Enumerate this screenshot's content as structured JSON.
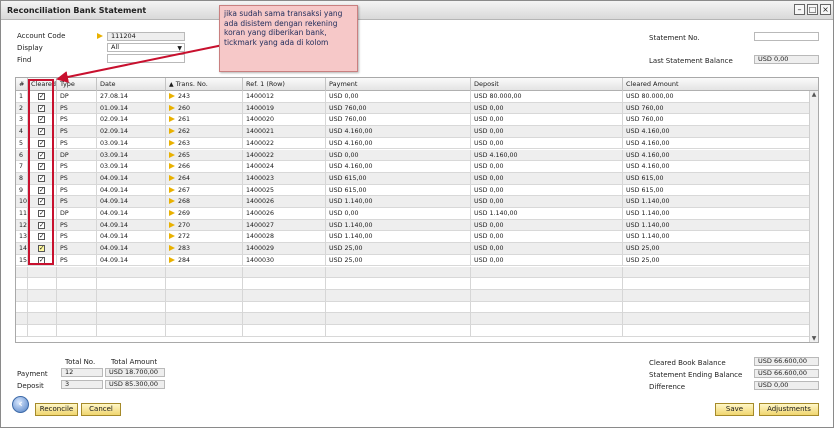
{
  "window": {
    "title": "Reconciliation Bank Statement"
  },
  "header": {
    "account_code_label": "Account Code",
    "account_code_value": "111204",
    "display_label": "Display",
    "display_value": "All",
    "find_label": "Find",
    "find_value": "",
    "statement_no_label": "Statement No.",
    "statement_no_value": "",
    "last_balance_label": "Last Statement Balance",
    "last_balance_value": "USD 0,00"
  },
  "callout": {
    "text": "jika sudah sama transaksi yang ada disistem dengan rekening koran yang diberikan bank, tickmark yang ada di kolom"
  },
  "grid": {
    "columns": [
      "#",
      "Cleared",
      "Type",
      "Date",
      "Trans. No.",
      "Ref. 1 (Row)",
      "Payment",
      "Deposit",
      "Cleared Amount"
    ],
    "sort_indicator": "▲",
    "rows": [
      {
        "num": "1",
        "type": "DP",
        "date": "27.08.14",
        "trans": "243",
        "ref": "1400012",
        "payment": "USD 0,00",
        "deposit": "USD 80.000,00",
        "cleared": "USD 80.000,00"
      },
      {
        "num": "2",
        "type": "PS",
        "date": "01.09.14",
        "trans": "260",
        "ref": "1400019",
        "payment": "USD 760,00",
        "deposit": "USD 0,00",
        "cleared": "USD 760,00"
      },
      {
        "num": "3",
        "type": "PS",
        "date": "02.09.14",
        "trans": "261",
        "ref": "1400020",
        "payment": "USD 760,00",
        "deposit": "USD 0,00",
        "cleared": "USD 760,00"
      },
      {
        "num": "4",
        "type": "PS",
        "date": "02.09.14",
        "trans": "262",
        "ref": "1400021",
        "payment": "USD 4.160,00",
        "deposit": "USD 0,00",
        "cleared": "USD 4.160,00"
      },
      {
        "num": "5",
        "type": "PS",
        "date": "03.09.14",
        "trans": "263",
        "ref": "1400022",
        "payment": "USD 4.160,00",
        "deposit": "USD 0,00",
        "cleared": "USD 4.160,00"
      },
      {
        "num": "6",
        "type": "DP",
        "date": "03.09.14",
        "trans": "265",
        "ref": "1400022",
        "payment": "USD 0,00",
        "deposit": "USD 4.160,00",
        "cleared": "USD 4.160,00"
      },
      {
        "num": "7",
        "type": "PS",
        "date": "03.09.14",
        "trans": "266",
        "ref": "1400024",
        "payment": "USD 4.160,00",
        "deposit": "USD 0,00",
        "cleared": "USD 4.160,00"
      },
      {
        "num": "8",
        "type": "PS",
        "date": "04.09.14",
        "trans": "264",
        "ref": "1400023",
        "payment": "USD 615,00",
        "deposit": "USD 0,00",
        "cleared": "USD 615,00"
      },
      {
        "num": "9",
        "type": "PS",
        "date": "04.09.14",
        "trans": "267",
        "ref": "1400025",
        "payment": "USD 615,00",
        "deposit": "USD 0,00",
        "cleared": "USD 615,00"
      },
      {
        "num": "10",
        "type": "PS",
        "date": "04.09.14",
        "trans": "268",
        "ref": "1400026",
        "payment": "USD 1.140,00",
        "deposit": "USD 0,00",
        "cleared": "USD 1.140,00"
      },
      {
        "num": "11",
        "type": "DP",
        "date": "04.09.14",
        "trans": "269",
        "ref": "1400026",
        "payment": "USD 0,00",
        "deposit": "USD 1.140,00",
        "cleared": "USD 1.140,00"
      },
      {
        "num": "12",
        "type": "PS",
        "date": "04.09.14",
        "trans": "270",
        "ref": "1400027",
        "payment": "USD 1.140,00",
        "deposit": "USD 0,00",
        "cleared": "USD 1.140,00"
      },
      {
        "num": "13",
        "type": "PS",
        "date": "04.09.14",
        "trans": "272",
        "ref": "1400028",
        "payment": "USD 1.140,00",
        "deposit": "USD 0,00",
        "cleared": "USD 1.140,00"
      },
      {
        "num": "14",
        "type": "PS",
        "date": "04.09.14",
        "trans": "283",
        "ref": "1400029",
        "payment": "USD 25,00",
        "deposit": "USD 0,00",
        "cleared": "USD 25,00"
      },
      {
        "num": "15",
        "type": "PS",
        "date": "04.09.14",
        "trans": "284",
        "ref": "1400030",
        "payment": "USD 25,00",
        "deposit": "USD 0,00",
        "cleared": "USD 25,00"
      }
    ]
  },
  "summary": {
    "total_no_label": "Total No.",
    "total_amount_label": "Total Amount",
    "payment_label": "Payment",
    "payment_count": "12",
    "payment_amount": "USD 18.700,00",
    "deposit_label": "Deposit",
    "deposit_count": "3",
    "deposit_amount": "USD 85.300,00",
    "cleared_book_label": "Cleared Book Balance",
    "cleared_book_value": "USD 66.600,00",
    "statement_ending_label": "Statement Ending Balance",
    "statement_ending_value": "USD 66.600,00",
    "difference_label": "Difference",
    "difference_value": "USD 0,00"
  },
  "buttons": {
    "reconcile": "Reconcile",
    "cancel": "Cancel",
    "save": "Save",
    "adjustments": "Adjustments"
  },
  "colors": {
    "highlight_box": "#c8102e",
    "callout_bg": "#f6c8c8",
    "button_bg": "#f0d56f",
    "link_arrow": "#e9b100"
  }
}
